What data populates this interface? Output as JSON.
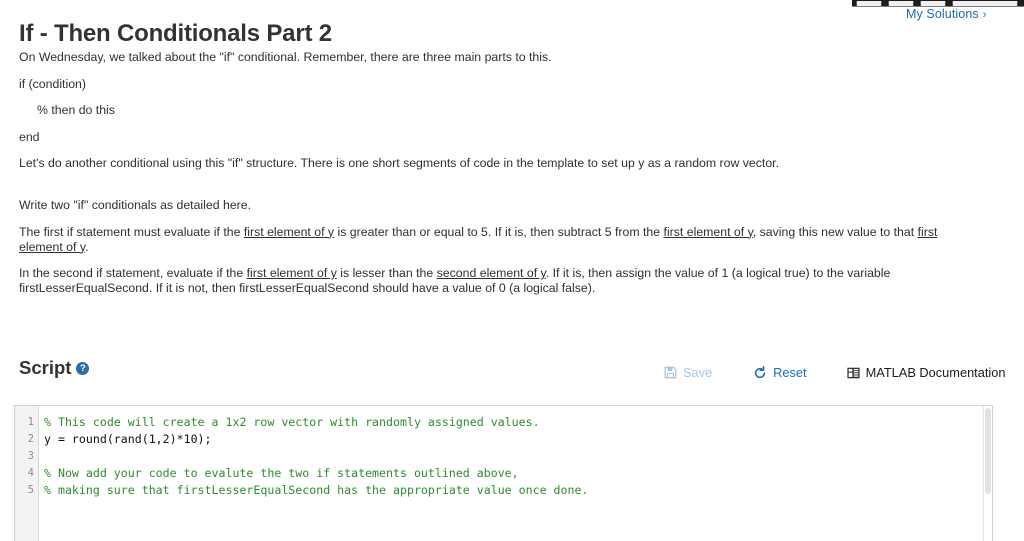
{
  "header": {
    "title": "If - Then Conditionals Part 2",
    "my_solutions_label": "My Solutions",
    "my_solutions_chevron": "›"
  },
  "instructions": {
    "paragraphs": [
      {
        "id": "intro",
        "text": "On Wednesday, we talked about the \"if\" conditional. Remember, there are three main parts to this."
      },
      {
        "id": "if-line",
        "text": "if (condition)"
      },
      {
        "id": "then-line",
        "text": "% then do this"
      },
      {
        "id": "end-line",
        "text": "end"
      },
      {
        "id": "template-note",
        "text": "Let's do another conditional using this \"if\" structure. There is one short segments of code in the template to set up y as a random row vector."
      },
      {
        "id": "write-two",
        "text": "Write two \"if\" conditionals as detailed here."
      }
    ],
    "first_if": {
      "part1": "The first if statement must evaluate if the ",
      "link1": "first element of y",
      "part2": " is greater than or equal to 5.  If it is, then subtract 5 from the ",
      "link2": "first element of y",
      "part3": ", saving this new value to that ",
      "link3": "first element of y",
      "part4": "."
    },
    "second_if": {
      "part1": "In the second if statement, evaluate if the ",
      "link1": "first element of y",
      "part2": " is lesser than the ",
      "link2": "second element of y",
      "part3": ".  If it is, then assign the value of 1 (a logical true) to the variable firstLesserEqualSecond.  If it is not, then firstLesserEqualSecond should have a value of 0 (a logical false)."
    }
  },
  "script_section": {
    "heading": "Script",
    "help_glyph": "?",
    "toolbar": {
      "save_label": "Save",
      "reset_label": "Reset",
      "doc_label": "MATLAB Documentation"
    }
  },
  "editor": {
    "line_numbers": [
      "1",
      "2",
      "3",
      "4",
      "5"
    ],
    "lines": [
      {
        "n": 1,
        "comment": "% This code will create a 1x2 row vector with randomly assigned values."
      },
      {
        "n": 2,
        "code": "y = round(rand(1,2)*10);"
      },
      {
        "n": 3,
        "code": ""
      },
      {
        "n": 4,
        "comment": "% Now add your code to evalute the two if statements outlined above,"
      },
      {
        "n": 5,
        "comment": "% making sure that firstLesserEqualSecond has the appropriate value once done."
      }
    ]
  },
  "colors": {
    "link_blue": "#1a6ca8",
    "accent_blue": "#1f6fb4",
    "disabled_blue": "#a8c6de",
    "comment_green": "#2e8b2e",
    "heading_gray": "#333333"
  }
}
